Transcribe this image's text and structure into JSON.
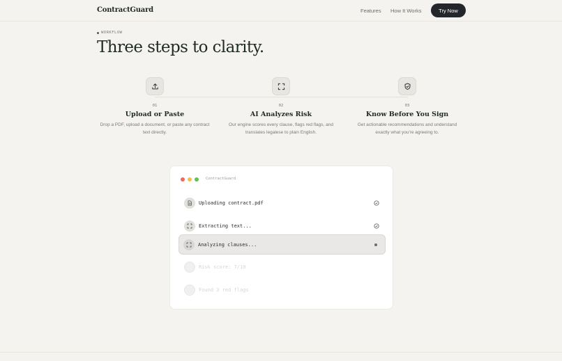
{
  "nav": {
    "brand": "ContractGuard",
    "links": [
      "Features",
      "How It Works"
    ],
    "cta": "Try Now"
  },
  "hero": {
    "eyebrow": "WORKFLOW",
    "headline": "Three steps to clarity."
  },
  "steps": [
    {
      "num": "01",
      "title": "Upload or Paste",
      "desc": "Drop a PDF, upload a document, or paste any contract text directly.",
      "icon": "upload-icon"
    },
    {
      "num": "02",
      "title": "AI Analyzes Risk",
      "desc": "Our engine scores every clause, flags red flags, and translates legalese to plain English.",
      "icon": "scan-icon"
    },
    {
      "num": "03",
      "title": "Know Before You Sign",
      "desc": "Get actionable recommendations and understand exactly what you're agreeing to.",
      "icon": "shield-check-icon"
    }
  ],
  "window": {
    "title": "ContractGuard",
    "tasks": [
      {
        "label": "Uploading contract.pdf",
        "state": "done",
        "icon": "document-icon"
      },
      {
        "label": "Extracting text...",
        "state": "done",
        "icon": "scan-icon"
      },
      {
        "label": "Analyzing clauses...",
        "state": "active",
        "icon": "scan-icon"
      },
      {
        "label": "Risk score: 7/10",
        "state": "pending",
        "icon": "circle-icon"
      },
      {
        "label": "Found 3 red flags",
        "state": "pending",
        "icon": "circle-icon"
      }
    ]
  },
  "colors": {
    "background": "#f5f3ef",
    "cta": "#23262a",
    "heading": "#1f2a22"
  }
}
